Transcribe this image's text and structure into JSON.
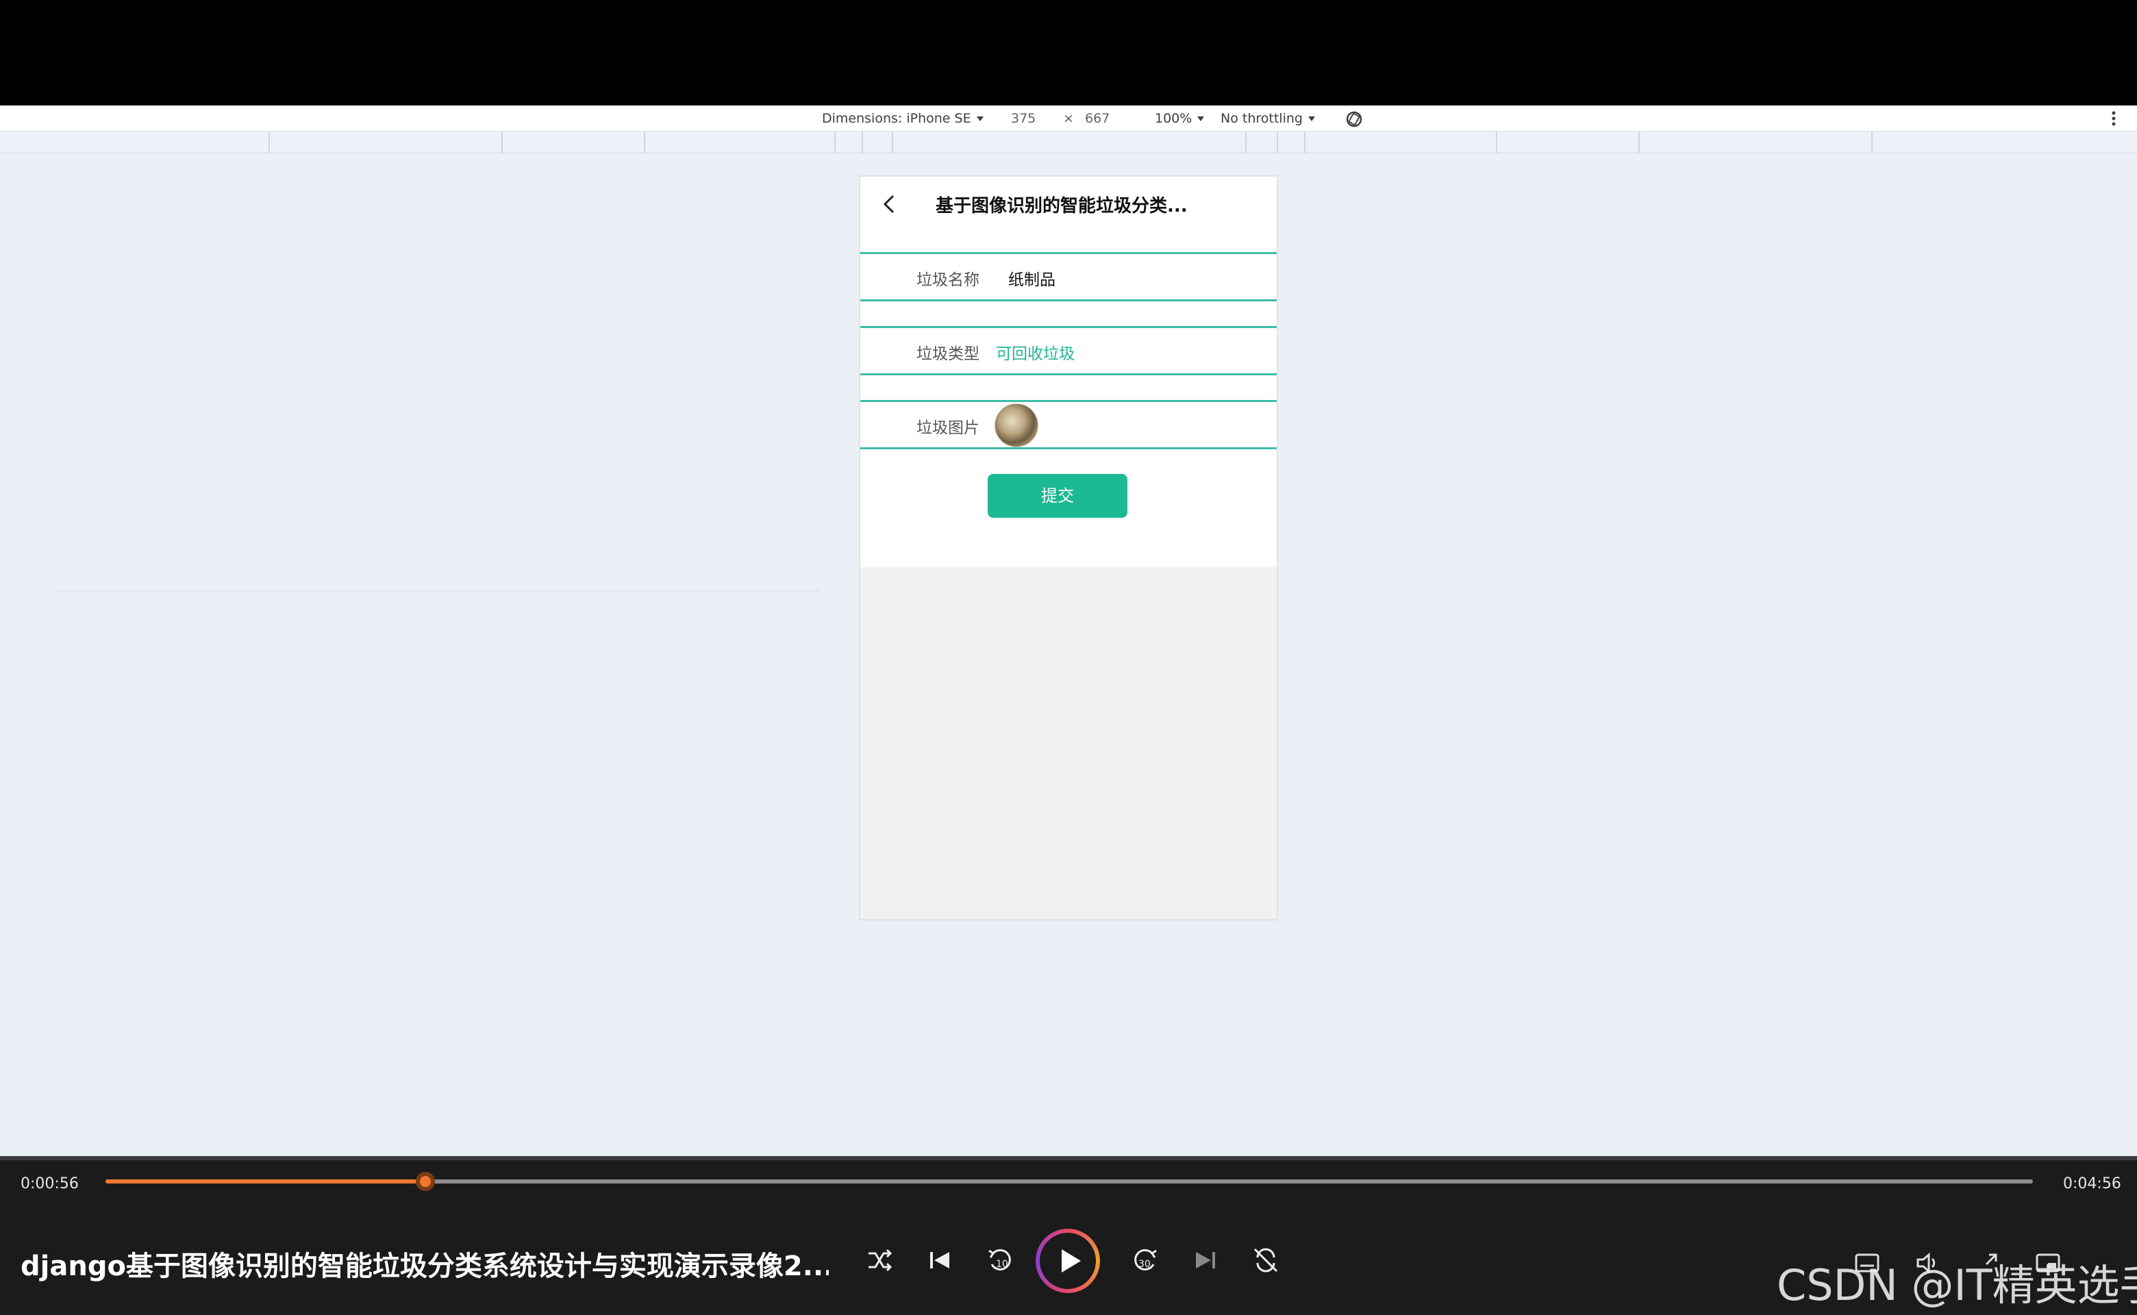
{
  "devtools": {
    "dimensions_label": "Dimensions: iPhone SE",
    "width": "375",
    "times": "×",
    "height": "667",
    "zoom": "100%",
    "throttling": "No throttling"
  },
  "app": {
    "title": "基于图像识别的智能垃圾分类...",
    "fields": [
      {
        "label": "垃圾名称",
        "value": "纸制品"
      },
      {
        "label": "垃圾类型",
        "value": "可回收垃圾"
      },
      {
        "label": "垃圾图片",
        "value": ""
      }
    ],
    "submit_label": "提交",
    "accent_color": "#1db894"
  },
  "player": {
    "current_time": "0:00:56",
    "duration": "0:04:56",
    "progress_fraction": 0.166,
    "title": "django基于图像识别的智能垃圾分类系统设计与实现演示录像2...",
    "watermark": "CSDN @IT精英选手",
    "replay_back": "10",
    "skip_forward": "30",
    "accent_color": "#f2772e"
  }
}
